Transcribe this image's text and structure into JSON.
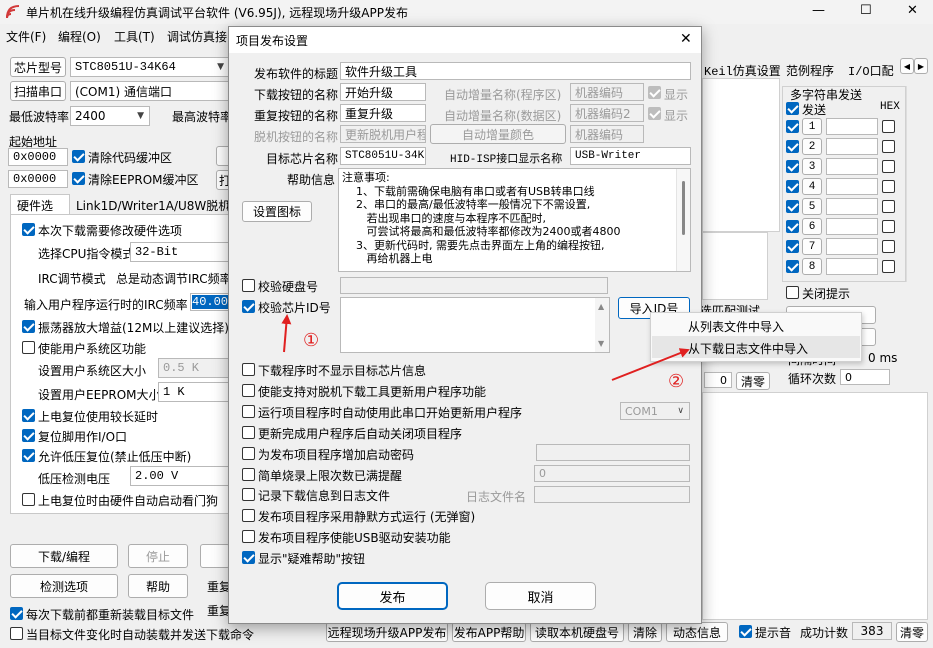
{
  "app": {
    "title": "单片机在线升级编程仿真调试平台软件 (V6.95J), 远程现场升级APP发布",
    "window_buttons": {
      "minimize": "—",
      "maximize": "☐",
      "close": "✕"
    },
    "menu": [
      "文件(F)",
      "编程(O)",
      "工具(T)",
      "调试仿真接"
    ],
    "chip_label": "芯片型号",
    "chip_value": "STC8051U-34K64",
    "scan_port_label": "扫描串口",
    "port_value": "(COM1) 通信端口",
    "min_baud_label": "最低波特率",
    "min_baud_value": "2400",
    "max_baud_label": "最高波特率",
    "start_addr_label": "起始地址",
    "addr1": "0x0000",
    "addr2": "0x0000",
    "clear_code_buf": "清除代码缓冲区",
    "clear_eeprom_buf": "清除EEPROM缓冲区",
    "btn_frag_1": "打",
    "tabs": [
      "硬件选项",
      "Link1D/Writer1A/U8W脱机",
      "程"
    ],
    "hw": {
      "modify_hw": "本次下载需要修改硬件选项",
      "cpu_mode_label": "选择CPU指令模式",
      "cpu_mode_value": "32-Bit",
      "irc_mode_label": "IRC调节模式",
      "irc_mode_value": "总是动态调节IRC频率",
      "irc_freq_label": "输入用户程序运行时的IRC频率",
      "irc_freq_value": "40.000",
      "osc_gain": "振荡器放大增益(12M以上建议选择)",
      "user_sys_area": "使能用户系统区功能",
      "sys_area_size_label": "设置用户系统区大小",
      "sys_area_size_value": "0.5 K",
      "eeprom_size_label": "设置用户EEPROM大小",
      "eeprom_size_value": "1   K",
      "reset_delay": "上电复位使用较长延时",
      "reset_pin_io": "复位脚用作I/O口",
      "lvd_reset": "允许低压复位(禁止低压中断)",
      "lvd_voltage_label": "低压检测电压",
      "lvd_voltage_value": "2.00 V",
      "hw_watchdog": "上电复位时由硬件自动启动看门狗"
    },
    "btn_download": "下载/编程",
    "btn_stop": "停止",
    "btn_detect": "检测选项",
    "btn_help": "帮助",
    "frag_reload": "重复",
    "frag_reload2": "重复",
    "reload_each": "每次下载前都重新装载目标文件",
    "reload_on_change": "当目标文件变化时自动装载并发送下载命令",
    "right_tabs": [
      "Keil仿真设置",
      "范例程序",
      "I/O口配"
    ],
    "multi_str": {
      "title": "多字符串发送",
      "send": "发送",
      "hex": "HEX",
      "rows": [
        "1",
        "2",
        "3",
        "4",
        "5",
        "6",
        "7",
        "8"
      ],
      "close_tip": "关闭提示",
      "loop_label": "循环次数",
      "loop_value": "0",
      "ms_unit": "0 ms",
      "interval_frag": "间隔时间"
    },
    "frag_test": "选匹配测试",
    "frag_zero": "0",
    "clear_btn1": "清零",
    "status_bar": {
      "remote_publish": "远程现场升级APP发布",
      "publish_help": "发布APP帮助",
      "read_disk": "读取本机硬盘号",
      "clear": "清除",
      "dyn_info": "动态信息",
      "beep": "提示音",
      "success_count_label": "成功计数",
      "success_count_value": "383",
      "clear_count": "清零"
    }
  },
  "dialog": {
    "title": "项目发布设置",
    "close": "✕",
    "publish_title_label": "发布软件的标题",
    "publish_title_value": "软件升级工具",
    "download_btn_name_label": "下载按钮的名称",
    "download_btn_name_value": "开始升级",
    "repeat_btn_name_label": "重复按钮的名称",
    "repeat_btn_name_value": "重复升级",
    "offline_btn_name_label": "脱机按钮的名称",
    "offline_btn_name_value": "更新脱机用户程",
    "auto_inc_prog_label": "自动增量名称(程序区)",
    "auto_inc_data_label": "自动增量名称(数据区)",
    "auto_inc_color_btn": "自动增量颜色",
    "machine_code_label": "机器编码",
    "machine_code2_label": "机器编码2",
    "machine_code_field": "机器编码",
    "show_label": "显示",
    "show2_label": "显示",
    "target_chip_label": "目标芯片名称",
    "target_chip_value": "STC8051U-34K64",
    "hid_label": "HID-ISP接口显示名称",
    "hid_value": "USB-Writer",
    "help_info_label": "帮助信息",
    "help_text": [
      "注意事项:",
      "    1、下载前需确保电脑有串口或者有USB转串口线",
      "    2、串口的最高/最低波特率一般情况下不需设置,",
      "       若出现串口的速度与本程序不匹配时,",
      "       可尝试将最高和最低波特率都修改为2400或者4800",
      "    3、更新代码时, 需要先点击界面左上角的编程按钮,",
      "       再给机器上电"
    ],
    "set_icon_btn": "设置图标",
    "verify_disk": "校验硬盘号",
    "verify_chip_id": "校验芯片ID号",
    "import_id_btn": "导入ID号",
    "options": [
      {
        "label": "下载程序时不显示目标芯片信息",
        "checked": false
      },
      {
        "label": "使能支持对脱机下载工具更新用户程序功能",
        "checked": false
      },
      {
        "label": "运行项目程序时自动使用此串口开始更新用户程序",
        "checked": false
      },
      {
        "label": "更新完成用户程序后自动关闭项目程序",
        "checked": false
      },
      {
        "label": "为发布项目程序增加启动密码",
        "checked": false
      },
      {
        "label": "简单烧录上限次数已满提醒",
        "checked": false
      },
      {
        "label": "记录下载信息到日志文件",
        "checked": false
      },
      {
        "label": "发布项目程序采用静默方式运行 (无弹窗)",
        "checked": false
      },
      {
        "label": "发布项目程序使能USB驱动安装功能",
        "checked": false
      },
      {
        "label": "显示\"疑难帮助\"按钮",
        "checked": true
      }
    ],
    "com_value": "COM1",
    "limit_value": "0",
    "log_file_label": "日志文件名",
    "publish_btn": "发布",
    "cancel_btn": "取消"
  },
  "context_menu": {
    "items": [
      "从列表文件中导入",
      "从下载日志文件中导入"
    ],
    "hovered_index": 1
  },
  "annotations": {
    "marker1": "①",
    "marker2": "②",
    "color": "#e02020"
  }
}
